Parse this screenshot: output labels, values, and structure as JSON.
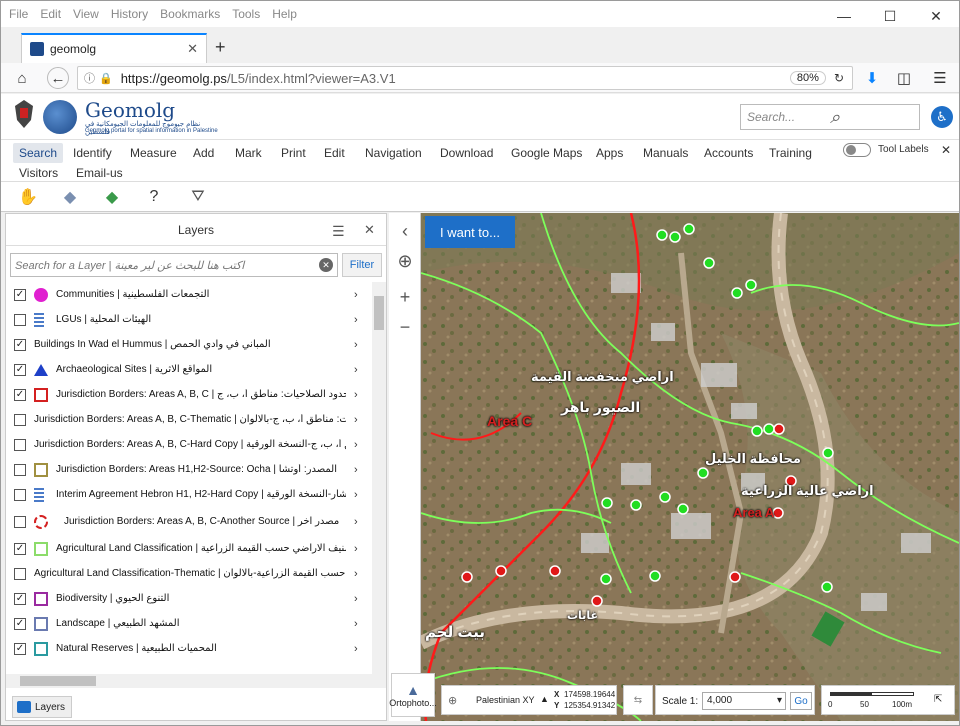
{
  "browser": {
    "menu": [
      "File",
      "Edit",
      "View",
      "History",
      "Bookmarks",
      "Tools",
      "Help"
    ],
    "tab_title": "geomolg",
    "url_domain": "https://geomolg.ps",
    "url_path": "/L5/index.html?viewer=A3.V1",
    "zoom": "80%"
  },
  "site": {
    "brand": "Geomolg",
    "brand_ar": "نظام جيوموج للمعلومات الجيومكانية في فلسطين",
    "brand_en": "Geomolg portal for spatial information in Palestine",
    "search_placeholder": "Search..."
  },
  "toolbar": {
    "tabs": [
      "Search",
      "Identify",
      "Measure",
      "Add",
      "Mark",
      "Print",
      "Edit",
      "Navigation",
      "Download",
      "Google Maps",
      "Apps",
      "Manuals",
      "Accounts",
      "Training"
    ],
    "row2": [
      "Visitors",
      "Email-us"
    ],
    "tool_labels": "Tool Labels"
  },
  "layers_panel": {
    "title": "Layers",
    "search_placeholder": "Search for a Layer | اكتب هنا للبحث عن لير معينة",
    "filter_label": "Filter",
    "tab_label": "Layers",
    "layers": [
      {
        "checked": true,
        "label": "Communities | التجمعات الفلسطينية",
        "symbol": "dot-magenta"
      },
      {
        "checked": false,
        "label": "LGUs | الهيئات المحلية",
        "symbol": "legend-list"
      },
      {
        "checked": true,
        "label": "Buildings In Wad el Hummus | المباني في وادي الحمص",
        "symbol": "none"
      },
      {
        "checked": true,
        "label": "Archaeological Sites | المواقع الاثرية",
        "symbol": "triangle-blue"
      },
      {
        "checked": true,
        "label": "Jurisdiction Borders: Areas A, B, C | حدود الصلاحيات: مناطق أ، ب، ج",
        "symbol": "square-red"
      },
      {
        "checked": false,
        "label": "Jurisdiction Borders: Areas A, B, C-Thematic | حدود الصلاحيات: مناطق أ، ب، ج-بالالوان",
        "symbol": "none"
      },
      {
        "checked": false,
        "label": "Jurisdiction Borders: Areas A, B, C-Hard Copy | مناطق أ، ب، ج-النسخة الورقية",
        "symbol": "none"
      },
      {
        "checked": false,
        "label": "Jurisdiction Borders: Areas H1,H2-Source: Ocha | المصدر: أوتشا",
        "symbol": "square-olive"
      },
      {
        "checked": false,
        "label": "Interim Agreement Hebron H1, H2-Hard Copy | الانتشار-النسخة الورقية",
        "symbol": "legend-list"
      },
      {
        "checked": false,
        "label": "Jurisdiction Borders: Areas A, B, C-Another Source | مصدر اخر",
        "symbol": "dashed-red"
      },
      {
        "checked": true,
        "label": "Agricultural Land Classification | تصنيف الاراضي حسب القيمة الزراعية",
        "symbol": "square-lightgreen"
      },
      {
        "checked": false,
        "label": "Agricultural Land Classification-Thematic | تصنيف الاراضي حسب القيمة الزراعية-بالالوان",
        "symbol": "none"
      },
      {
        "checked": true,
        "label": "Biodiversity | التنوع الحيوي",
        "symbol": "square-purple"
      },
      {
        "checked": true,
        "label": "Landscape | المشهد الطبيعي",
        "symbol": "square-slate"
      },
      {
        "checked": true,
        "label": "Natural Reserves | المحميات الطبيعية",
        "symbol": "square-teal"
      }
    ]
  },
  "map": {
    "i_want_to": "I want to...",
    "labels": [
      {
        "text": "Area C",
        "color": "#d42020"
      },
      {
        "text": "Area A",
        "color": "#d42020"
      },
      {
        "text": "اراضي منخفضة القيمة",
        "color": "#ffffff"
      },
      {
        "text": "الصيور باهر",
        "color": "#ffffff"
      },
      {
        "text": "محافظة الخليل",
        "color": "#ffffff"
      },
      {
        "text": "اراضي عالية الزراعية",
        "color": "#ffffff"
      },
      {
        "text": "بيت لحم",
        "color": "#ffffff"
      },
      {
        "text": "غابات",
        "color": "#ffffff"
      }
    ]
  },
  "status": {
    "basemap": "Ortophoto...",
    "projection": "Palestinian XY",
    "x_label": "X",
    "x_value": "174598.19644",
    "y_label": "Y",
    "y_value": "125354.91342",
    "scale_label": "Scale 1:",
    "scale_value": "4,000",
    "go_label": "Go",
    "scalebar": [
      "0",
      "50",
      "100m"
    ]
  },
  "colors": {
    "accent": "#1e6fc8",
    "brand": "#1e4a8a",
    "green_point": "#22dd22",
    "red_point": "#e01818"
  }
}
